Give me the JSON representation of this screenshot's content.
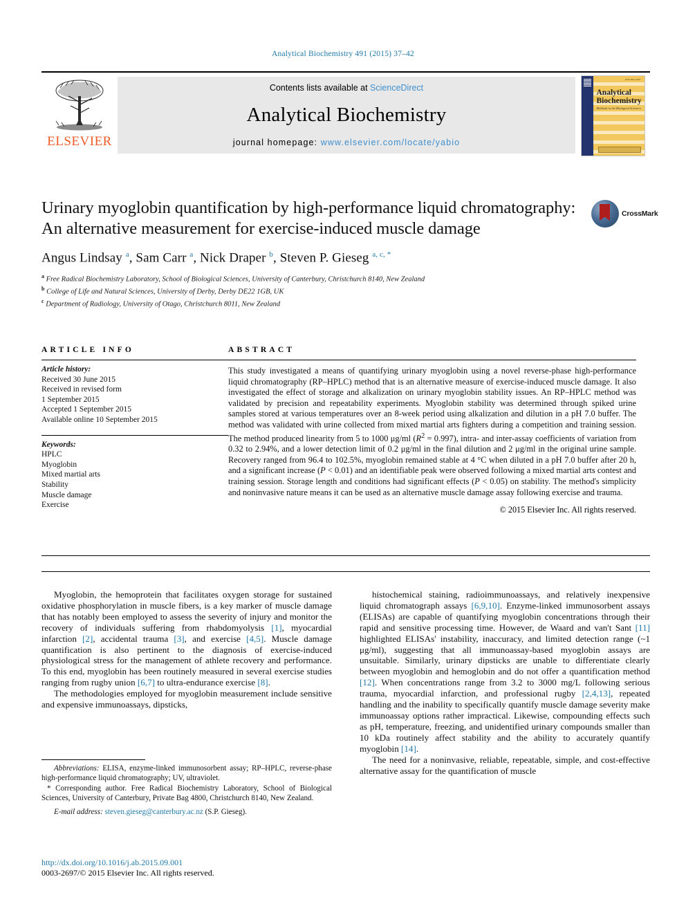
{
  "running_head": "Analytical Biochemistry 491 (2015) 37–42",
  "masthead": {
    "publisher": "ELSEVIER",
    "contents_prefix": "Contents lists available at ",
    "contents_link": "ScienceDirect",
    "journal_name": "Analytical Biochemistry",
    "homepage_prefix": "journal homepage: ",
    "homepage_url": "www.elsevier.com/locate/yabio",
    "cover": {
      "title_line1": "Analytical",
      "title_line2": "Biochemistry",
      "subtitle": "Methods in the Biological Sciences",
      "top_note": "ISSN 0003-2697"
    },
    "accent_orange": "#ef5b26",
    "accent_link": "#3f8fcf"
  },
  "article": {
    "title": "Urinary myoglobin quantification by high-performance liquid chromatography: An alternative measurement for exercise-induced muscle damage",
    "crossmark_label": "CrossMark",
    "authors_html": "Angus Lindsay <sup>a</sup>, Sam Carr <sup>a</sup>, Nick Draper <sup>b</sup>, Steven P. Gieseg <sup>a, c, *</sup>",
    "affiliations": [
      {
        "mark": "a",
        "text": "Free Radical Biochemistry Laboratory, School of Biological Sciences, University of Canterbury, Christchurch 8140, New Zealand"
      },
      {
        "mark": "b",
        "text": "College of Life and Natural Sciences, University of Derby, Derby DE22 1GB, UK"
      },
      {
        "mark": "c",
        "text": "Department of Radiology, University of Otago, Christchurch 8011, New Zealand"
      }
    ]
  },
  "article_info": {
    "heading": "ARTICLE INFO",
    "history_label": "Article history:",
    "history": [
      "Received 30 June 2015",
      "Received in revised form",
      "1 September 2015",
      "Accepted 1 September 2015",
      "Available online 10 September 2015"
    ],
    "keywords_label": "Keywords:",
    "keywords": [
      "HPLC",
      "Myoglobin",
      "Mixed martial arts",
      "Stability",
      "Muscle damage",
      "Exercise"
    ]
  },
  "abstract": {
    "heading": "ABSTRACT",
    "text": "This study investigated a means of quantifying urinary myoglobin using a novel reverse-phase high-performance liquid chromatography (RP–HPLC) method that is an alternative measure of exercise-induced muscle damage. It also investigated the effect of storage and alkalization on urinary myoglobin stability issues. An RP–HPLC method was validated by precision and repeatability experiments. Myoglobin stability was determined through spiked urine samples stored at various temperatures over an 8-week period using alkalization and dilution in a pH 7.0 buffer. The method was validated with urine collected from mixed martial arts fighters during a competition and training session. The method produced linearity from 5 to 1000 μg/ml (R2 = 0.997), intra- and inter-assay coefficients of variation from 0.32 to 2.94%, and a lower detection limit of 0.2 μg/ml in the final dilution and 2 μg/ml in the original urine sample. Recovery ranged from 96.4 to 102.5%, myoglobin remained stable at 4 °C when diluted in a pH 7.0 buffer after 20 h, and a significant increase (P < 0.01) and an identifiable peak were observed following a mixed martial arts contest and training session. Storage length and conditions had significant effects (P < 0.05) on stability. The method's simplicity and noninvasive nature means it can be used as an alternative muscle damage assay following exercise and trauma.",
    "copyright": "© 2015 Elsevier Inc. All rights reserved."
  },
  "body": {
    "left_paragraphs": [
      "Myoglobin, the hemoprotein that facilitates oxygen storage for sustained oxidative phosphorylation in muscle fibers, is a key marker of muscle damage that has notably been employed to assess the severity of injury and monitor the recovery of individuals suffering from rhabdomyolysis [1], myocardial infarction [2], accidental trauma [3], and exercise [4,5]. Muscle damage quantification is also pertinent to the diagnosis of exercise-induced physiological stress for the management of athlete recovery and performance. To this end, myoglobin has been routinely measured in several exercise studies ranging from rugby union [6,7] to ultra-endurance exercise [8].",
      "The methodologies employed for myoglobin measurement include sensitive and expensive immunoassays, dipsticks,"
    ],
    "right_paragraphs": [
      "histochemical staining, radioimmunoassays, and relatively inexpensive liquid chromatograph assays [6,9,10]. Enzyme-linked immunosorbent assays (ELISAs) are capable of quantifying myoglobin concentrations through their rapid and sensitive processing time. However, de Waard and van't Sant [11] highlighted ELISAs' instability, inaccuracy, and limited detection range (~1 μg/ml), suggesting that all immunoassay-based myoglobin assays are unsuitable. Similarly, urinary dipsticks are unable to differentiate clearly between myoglobin and hemoglobin and do not offer a quantification method [12]. When concentrations range from 3.2 to 3000 mg/L following serious trauma, myocardial infarction, and professional rugby [2,4,13], repeated handling and the inability to specifically quantify muscle damage severity make immunoassay options rather impractical. Likewise, compounding effects such as pH, temperature, freezing, and unidentified urinary compounds smaller than 10 kDa routinely affect stability and the ability to accurately quantify myoglobin [14].",
      "The need for a noninvasive, reliable, repeatable, simple, and cost-effective alternative assay for the quantification of muscle"
    ]
  },
  "footnotes": {
    "abbrev_label": "Abbreviations:",
    "abbrev_text": " ELISA, enzyme-linked immunosorbent assay; RP–HPLC, reverse-phase high-performance liquid chromatography; UV, ultraviolet.",
    "corresponding": "* Corresponding author. Free Radical Biochemistry Laboratory, School of Biological Sciences, University of Canterbury, Private Bag 4800, Christchurch 8140, New Zealand.",
    "email_label": "E-mail address:",
    "email": "steven.gieseg@canterbury.ac.nz",
    "email_owner": " (S.P. Gieseg)."
  },
  "footer": {
    "doi": "http://dx.doi.org/10.1016/j.ab.2015.09.001",
    "issn_line": "0003-2697/© 2015 Elsevier Inc. All rights reserved."
  }
}
